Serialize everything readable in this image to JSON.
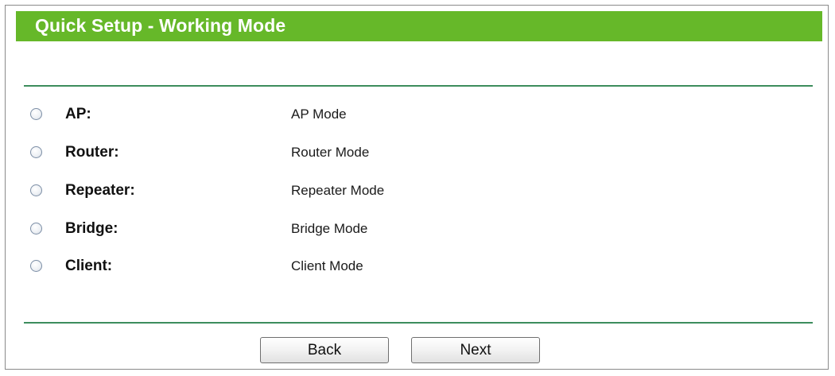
{
  "header": {
    "title": "Quick Setup - Working Mode"
  },
  "colors": {
    "title_bar": "#66b829",
    "rule": "#3d8d5d"
  },
  "modes": [
    {
      "label": "AP:",
      "description": "AP Mode",
      "selected": false
    },
    {
      "label": "Router:",
      "description": "Router Mode",
      "selected": false
    },
    {
      "label": "Repeater:",
      "description": "Repeater Mode",
      "selected": false
    },
    {
      "label": "Bridge:",
      "description": "Bridge Mode",
      "selected": false
    },
    {
      "label": "Client:",
      "description": "Client Mode",
      "selected": false
    }
  ],
  "buttons": {
    "back_label": "Back",
    "next_label": "Next"
  }
}
